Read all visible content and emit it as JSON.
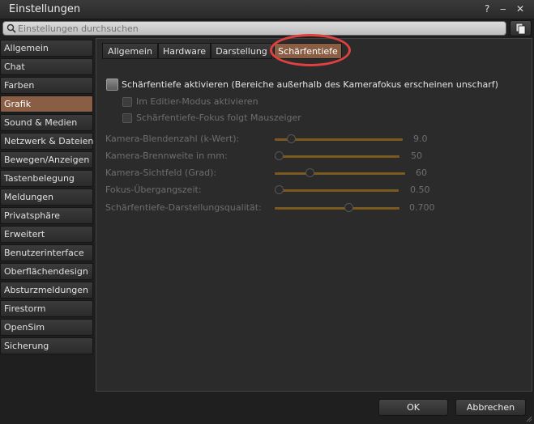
{
  "window": {
    "title": "Einstellungen",
    "help_label": "?",
    "minimize_label": "‒",
    "close_label": "✕"
  },
  "search": {
    "placeholder": "Einstellungen durchsuchen",
    "icon": "search-icon"
  },
  "sidebar": {
    "items": [
      {
        "label": "Allgemein"
      },
      {
        "label": "Chat"
      },
      {
        "label": "Farben"
      },
      {
        "label": "Grafik",
        "active": true
      },
      {
        "label": "Sound & Medien"
      },
      {
        "label": "Netzwerk & Dateien"
      },
      {
        "label": "Bewegen/Anzeigen"
      },
      {
        "label": "Tastenbelegung"
      },
      {
        "label": "Meldungen"
      },
      {
        "label": "Privatsphäre"
      },
      {
        "label": "Erweitert"
      },
      {
        "label": "Benutzerinterface"
      },
      {
        "label": "Oberflächendesign"
      },
      {
        "label": "Absturzmeldungen"
      },
      {
        "label": "Firestorm"
      },
      {
        "label": "OpenSim"
      },
      {
        "label": "Sicherung"
      }
    ]
  },
  "tabs": [
    {
      "label": "Allgemein"
    },
    {
      "label": "Hardware"
    },
    {
      "label": "Darstellung"
    },
    {
      "label": "Schärfentiefe",
      "active": true
    }
  ],
  "dof": {
    "enable_label": "Schärfentiefe aktivieren (Bereiche außerhalb des Kamerafokus erscheinen unscharf)",
    "edit_mode_label": "Im Editier-Modus aktivieren",
    "focus_follows_mouse_label": "Schärfentiefe-Fokus folgt Mauszeiger",
    "sliders": [
      {
        "label": "Kamera-Blendenzahl (k-Wert):",
        "value": "9.0",
        "level": 0.1
      },
      {
        "label": "Kamera-Brennweite in mm:",
        "value": "50",
        "level": 0.0
      },
      {
        "label": "Kamera-Sichtfeld (Grad):",
        "value": "60",
        "level": 0.25
      },
      {
        "label": "Fokus-Übergangszeit:",
        "value": "0.50",
        "level": 0.0
      },
      {
        "label": "Schärfentiefe-Darstellungsqualität:",
        "value": "0.700",
        "level": 0.6
      }
    ]
  },
  "buttons": {
    "ok": "OK",
    "cancel": "Abbrechen"
  },
  "colors": {
    "accent": "#8a5e44",
    "highlight_ring": "#e04040",
    "slider_track": "#7a5a1e"
  }
}
